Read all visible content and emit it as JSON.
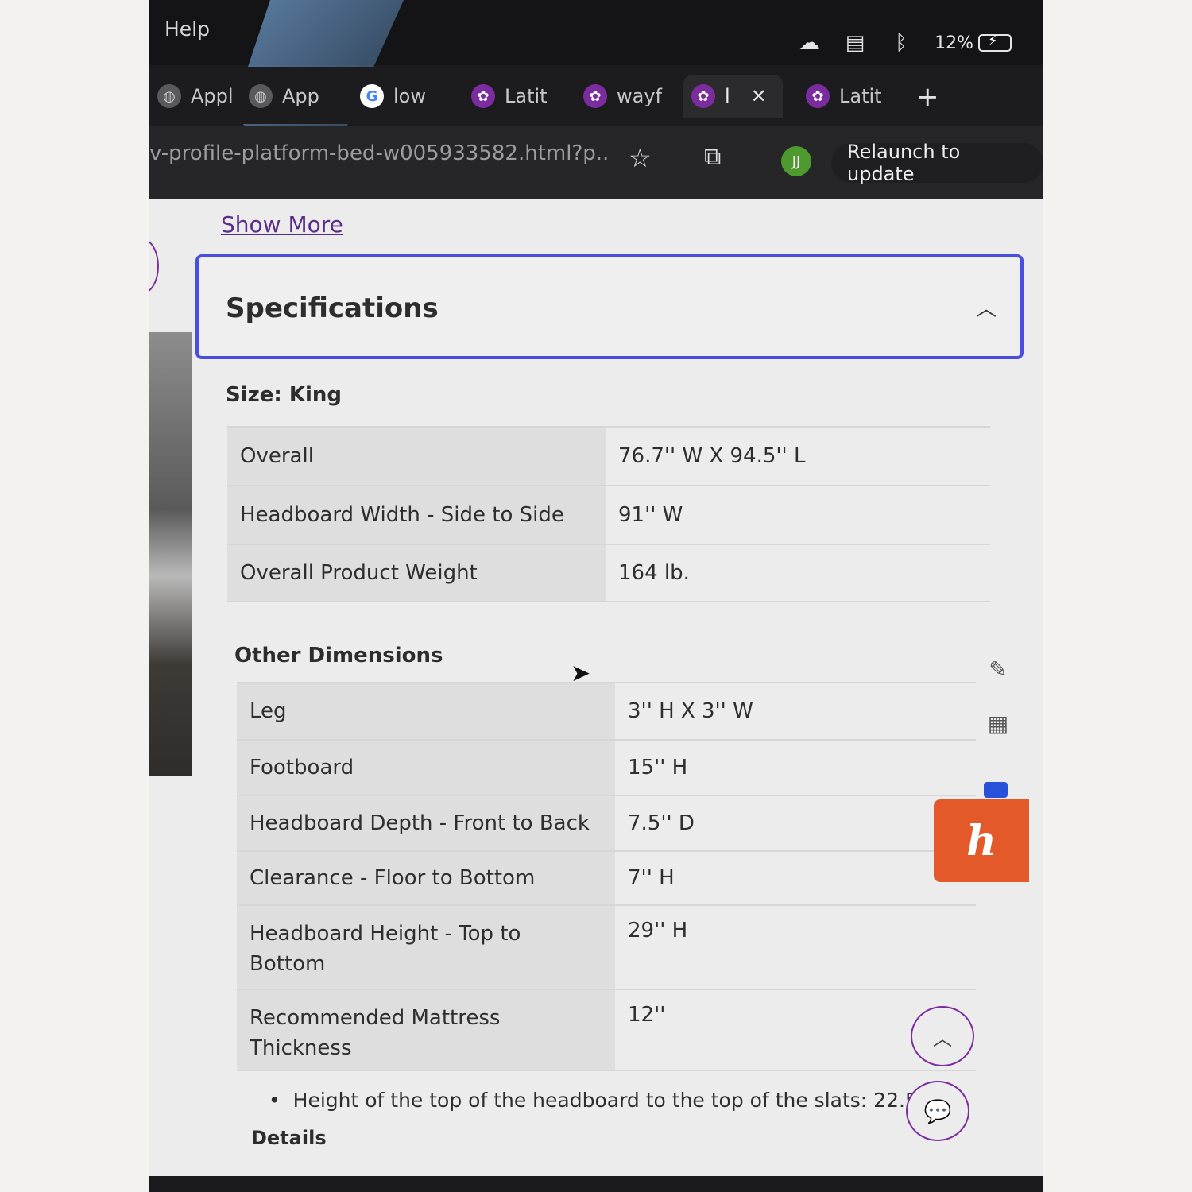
{
  "menubar": {
    "help_label": "Help",
    "battery_text": "12%",
    "icons": [
      "cloud-sync-icon",
      "folder-stack-icon",
      "bluetooth-icon",
      "battery-charging-icon"
    ]
  },
  "tabs": [
    {
      "label": "Appl",
      "icon": "globe-icon"
    },
    {
      "label": "App",
      "icon": "globe-icon"
    },
    {
      "label": "low",
      "icon": "google-icon"
    },
    {
      "label": "Latit",
      "icon": "wayfair-icon"
    },
    {
      "label": "wayf",
      "icon": "wayfair-icon"
    },
    {
      "label": "l",
      "icon": "wayfair-icon",
      "active": true
    },
    {
      "label": "Latit",
      "icon": "wayfair-icon"
    }
  ],
  "toolbar": {
    "url": "v-profile-platform-bed-w005933582.html?p...",
    "avatar_initials": "JJ",
    "relaunch_label": "Relaunch to update"
  },
  "page": {
    "show_more": "Show More",
    "specifications_title": "Specifications",
    "size_label": "Size: King",
    "size_rows": [
      {
        "key": "Overall",
        "value": "76.7'' W X 94.5'' L"
      },
      {
        "key": "Headboard Width - Side to Side",
        "value": "91'' W"
      },
      {
        "key": "Overall Product Weight",
        "value": "164 lb."
      }
    ],
    "other_dimensions_label": "Other Dimensions",
    "other_rows": [
      {
        "key": "Leg",
        "value": "3'' H X 3'' W"
      },
      {
        "key": "Footboard",
        "value": "15'' H"
      },
      {
        "key": "Headboard Depth - Front to Back",
        "value": "7.5'' D"
      },
      {
        "key": "Clearance - Floor to Bottom",
        "value": "7'' H"
      },
      {
        "key": "Headboard Height - Top to Bottom",
        "value": "29'' H"
      },
      {
        "key": "Recommended Mattress Thickness",
        "value": "12''"
      }
    ],
    "bullet_note": "Height of the top of the headboard to the top of the slats: 22.5\"",
    "details_label": "Details"
  },
  "colors": {
    "accent_purple": "#7b2c9e",
    "spec_border": "#4a4ee0",
    "honey_orange": "#e3592a"
  }
}
